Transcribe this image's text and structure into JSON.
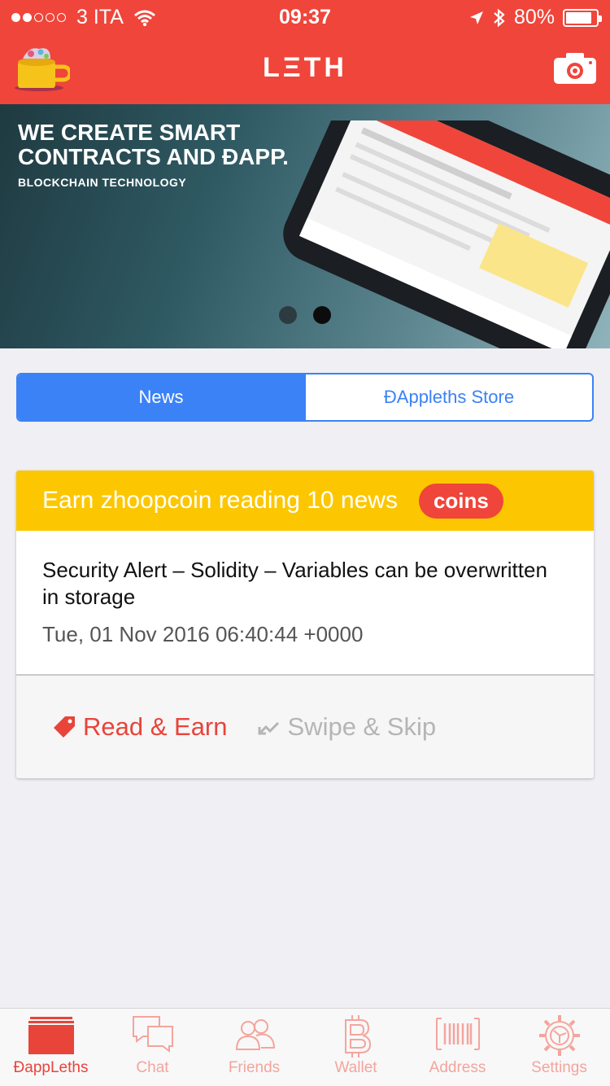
{
  "status_bar": {
    "carrier": "3 ITA",
    "time": "09:37",
    "battery": "80%",
    "signal_bars_filled": 2,
    "signal_bars_total": 5,
    "battery_level": 0.8
  },
  "navbar": {
    "title": "LΞTH",
    "logo_icon": "coffee-mug-logo",
    "camera_icon": "camera-icon"
  },
  "banner": {
    "headline": "WE CREATE SMART CONTRACTS AND ĐAPP.",
    "subheadline": "BLOCKCHAIN TECHNOLOGY",
    "pages": 2,
    "active_page": 2
  },
  "segments": [
    {
      "label": "News",
      "active": true
    },
    {
      "label": "ĐAppleths Store",
      "active": false
    }
  ],
  "card": {
    "promo_text": "Earn zhoopcoin reading 10 news",
    "badge": "coins",
    "article_title": "Security Alert – Solidity – Variables can be overwritten in storage",
    "article_date": "Tue, 01 Nov 2016 06:40:44 +0000",
    "read_label": "Read & Earn",
    "skip_label": "Swipe & Skip"
  },
  "tabs": [
    {
      "label": "ĐappLeths",
      "icon": "dappleths-icon",
      "active": true
    },
    {
      "label": "Chat",
      "icon": "chat-icon",
      "active": false
    },
    {
      "label": "Friends",
      "icon": "friends-icon",
      "active": false
    },
    {
      "label": "Wallet",
      "icon": "bitcoin-icon",
      "active": false
    },
    {
      "label": "Address",
      "icon": "barcode-icon",
      "active": false
    },
    {
      "label": "Settings",
      "icon": "gear-icon",
      "active": false
    }
  ],
  "colors": {
    "brand_red": "#f0453a",
    "accent_blue": "#3b82f6",
    "promo_yellow": "#fcc700",
    "tab_inactive": "#f4a49d"
  }
}
